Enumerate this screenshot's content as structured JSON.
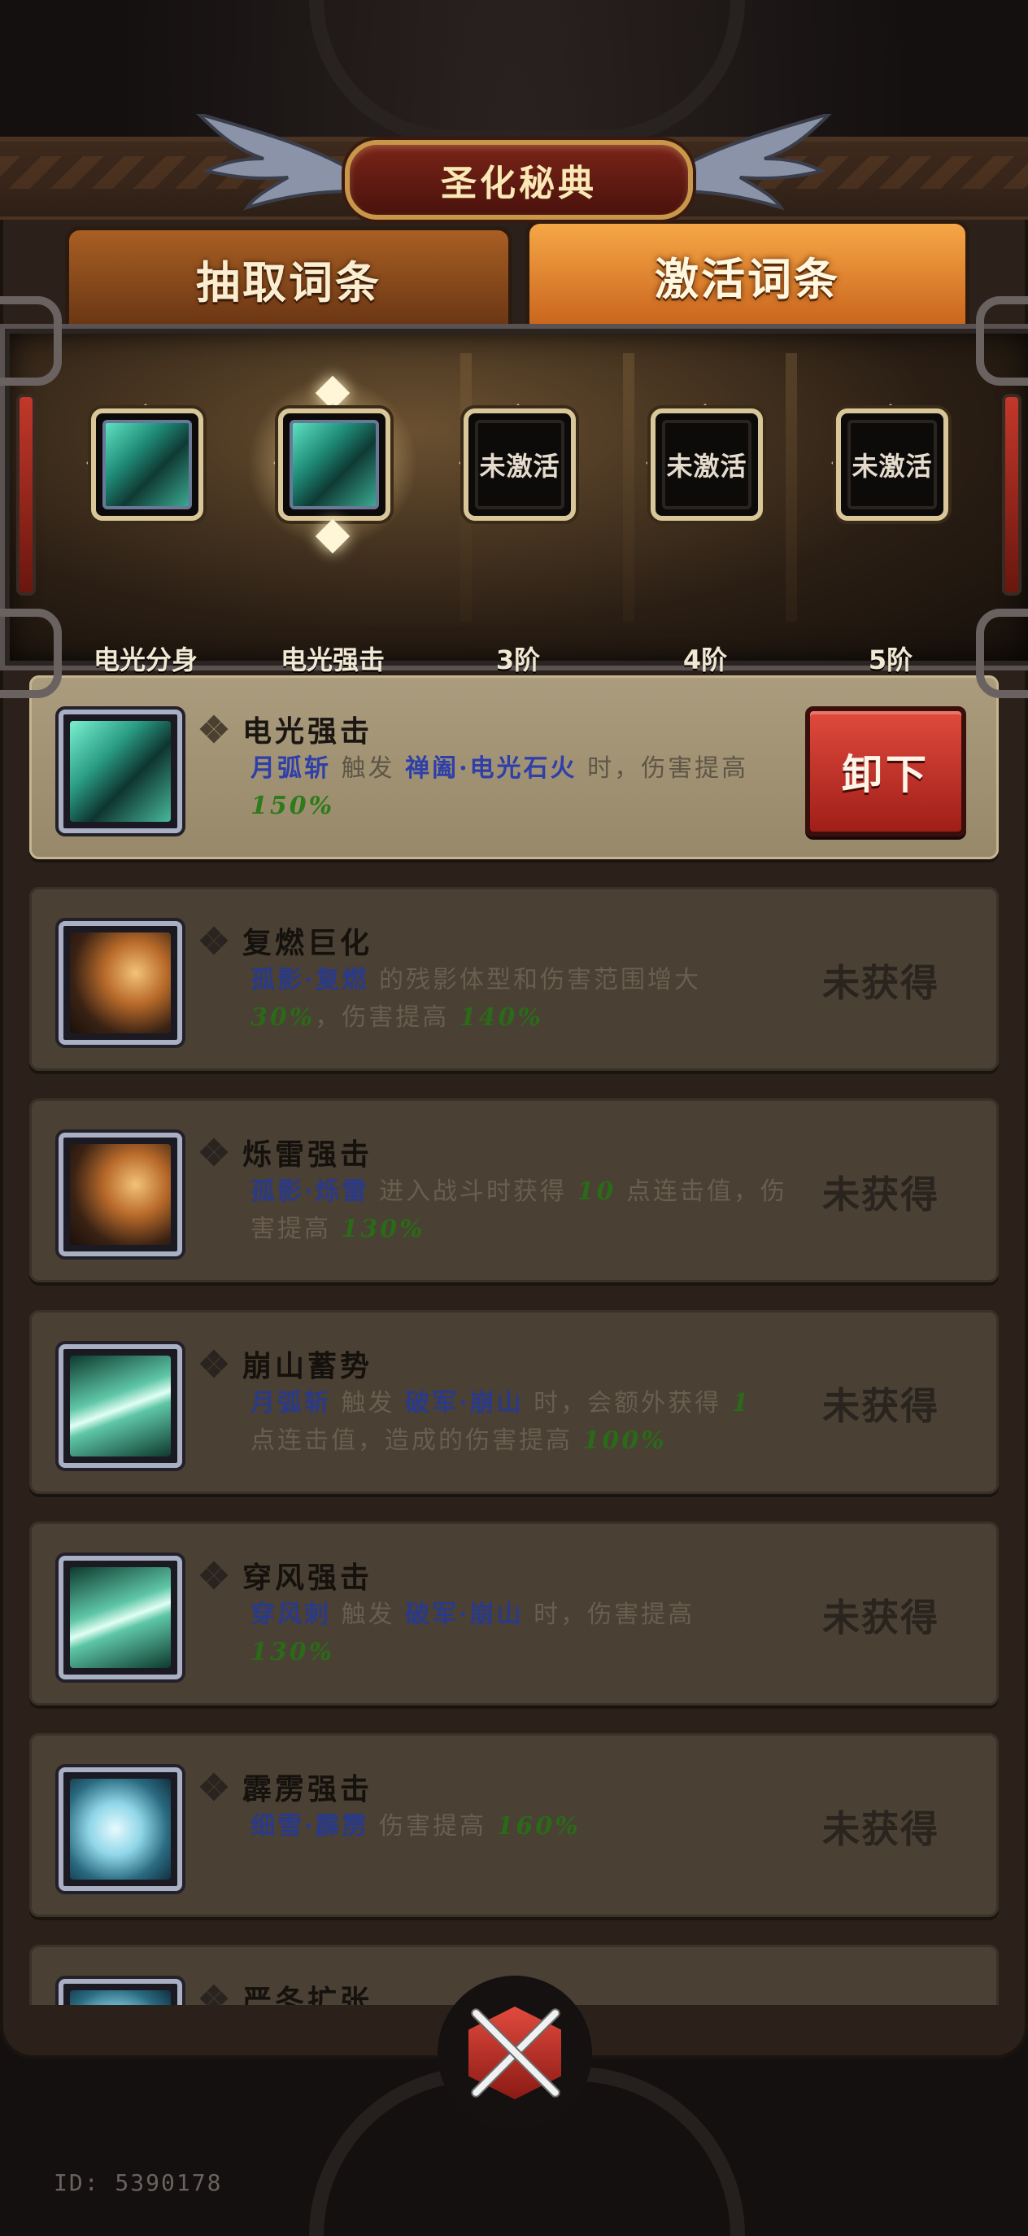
{
  "title": "圣化秘典",
  "tabs": [
    {
      "label": "抽取词条",
      "active": false
    },
    {
      "label": "激活词条",
      "active": true
    }
  ],
  "slots": [
    {
      "label": "电光分身",
      "state": "active",
      "icon": "green-blade-icon"
    },
    {
      "label": "电光强击",
      "state": "active",
      "icon": "green-blade-icon"
    },
    {
      "label": "3阶",
      "state": "empty",
      "text": "未激活"
    },
    {
      "label": "4阶",
      "state": "empty",
      "text": "未激活"
    },
    {
      "label": "5阶",
      "state": "empty",
      "text": "未激活"
    }
  ],
  "entries": [
    {
      "title": "电光强击",
      "status": "equipped",
      "action_label": "卸下",
      "desc_parts": [
        {
          "t": "月弧斩",
          "s": "blue"
        },
        {
          "t": " 触发 ",
          "s": ""
        },
        {
          "t": "禅阖·电光石火",
          "s": "blue"
        },
        {
          "t": " 时，伤害提高 ",
          "s": ""
        },
        {
          "t": "150%",
          "s": "green"
        }
      ],
      "icon": "green-blade-icon"
    },
    {
      "title": "复燃巨化",
      "status_label": "未获得",
      "desc_parts": [
        {
          "t": "孤影·复燃",
          "s": "blue"
        },
        {
          "t": " 的残影体型和伤害范围增大 ",
          "s": ""
        },
        {
          "t": "30%",
          "s": "green"
        },
        {
          "t": "，伤害提高 ",
          "s": ""
        },
        {
          "t": "140%",
          "s": "green"
        }
      ],
      "icon": "shadow-warrior-icon"
    },
    {
      "title": "烁雷强击",
      "status_label": "未获得",
      "desc_parts": [
        {
          "t": "孤影·烁雷",
          "s": "blue"
        },
        {
          "t": " 进入战斗时获得 ",
          "s": ""
        },
        {
          "t": "10",
          "s": "green"
        },
        {
          "t": " 点连击值，伤害提高 ",
          "s": ""
        },
        {
          "t": "130%",
          "s": "green"
        }
      ],
      "icon": "shadow-warrior-icon"
    },
    {
      "title": "崩山蓄势",
      "status_label": "未获得",
      "desc_parts": [
        {
          "t": "月弧斩",
          "s": "blue"
        },
        {
          "t": " 触发 ",
          "s": ""
        },
        {
          "t": "破军·崩山",
          "s": "blue"
        },
        {
          "t": " 时，会额外获得 ",
          "s": ""
        },
        {
          "t": "1",
          "s": "green"
        },
        {
          "t": " 点连击值，造成的伤害提高 ",
          "s": ""
        },
        {
          "t": "100%",
          "s": "green"
        }
      ],
      "icon": "leaf-slash-icon"
    },
    {
      "title": "穿风强击",
      "status_label": "未获得",
      "desc_parts": [
        {
          "t": "穿风刺",
          "s": "blue"
        },
        {
          "t": " 触发 ",
          "s": ""
        },
        {
          "t": "破军·崩山",
          "s": "blue"
        },
        {
          "t": " 时，伤害提高 ",
          "s": ""
        },
        {
          "t": "130%",
          "s": "green"
        }
      ],
      "icon": "leaf-slash-icon"
    },
    {
      "title": "霹雳强击",
      "status_label": "未获得",
      "desc_parts": [
        {
          "t": "细雪·霹雳",
          "s": "blue"
        },
        {
          "t": " 伤害提高 ",
          "s": ""
        },
        {
          "t": "160%",
          "s": "green"
        }
      ],
      "icon": "ice-burst-icon"
    },
    {
      "title": "严冬扩张",
      "status_label": "",
      "desc_parts": [],
      "icon": "ice-burst-icon"
    }
  ],
  "user_id": "ID: 5390178"
}
